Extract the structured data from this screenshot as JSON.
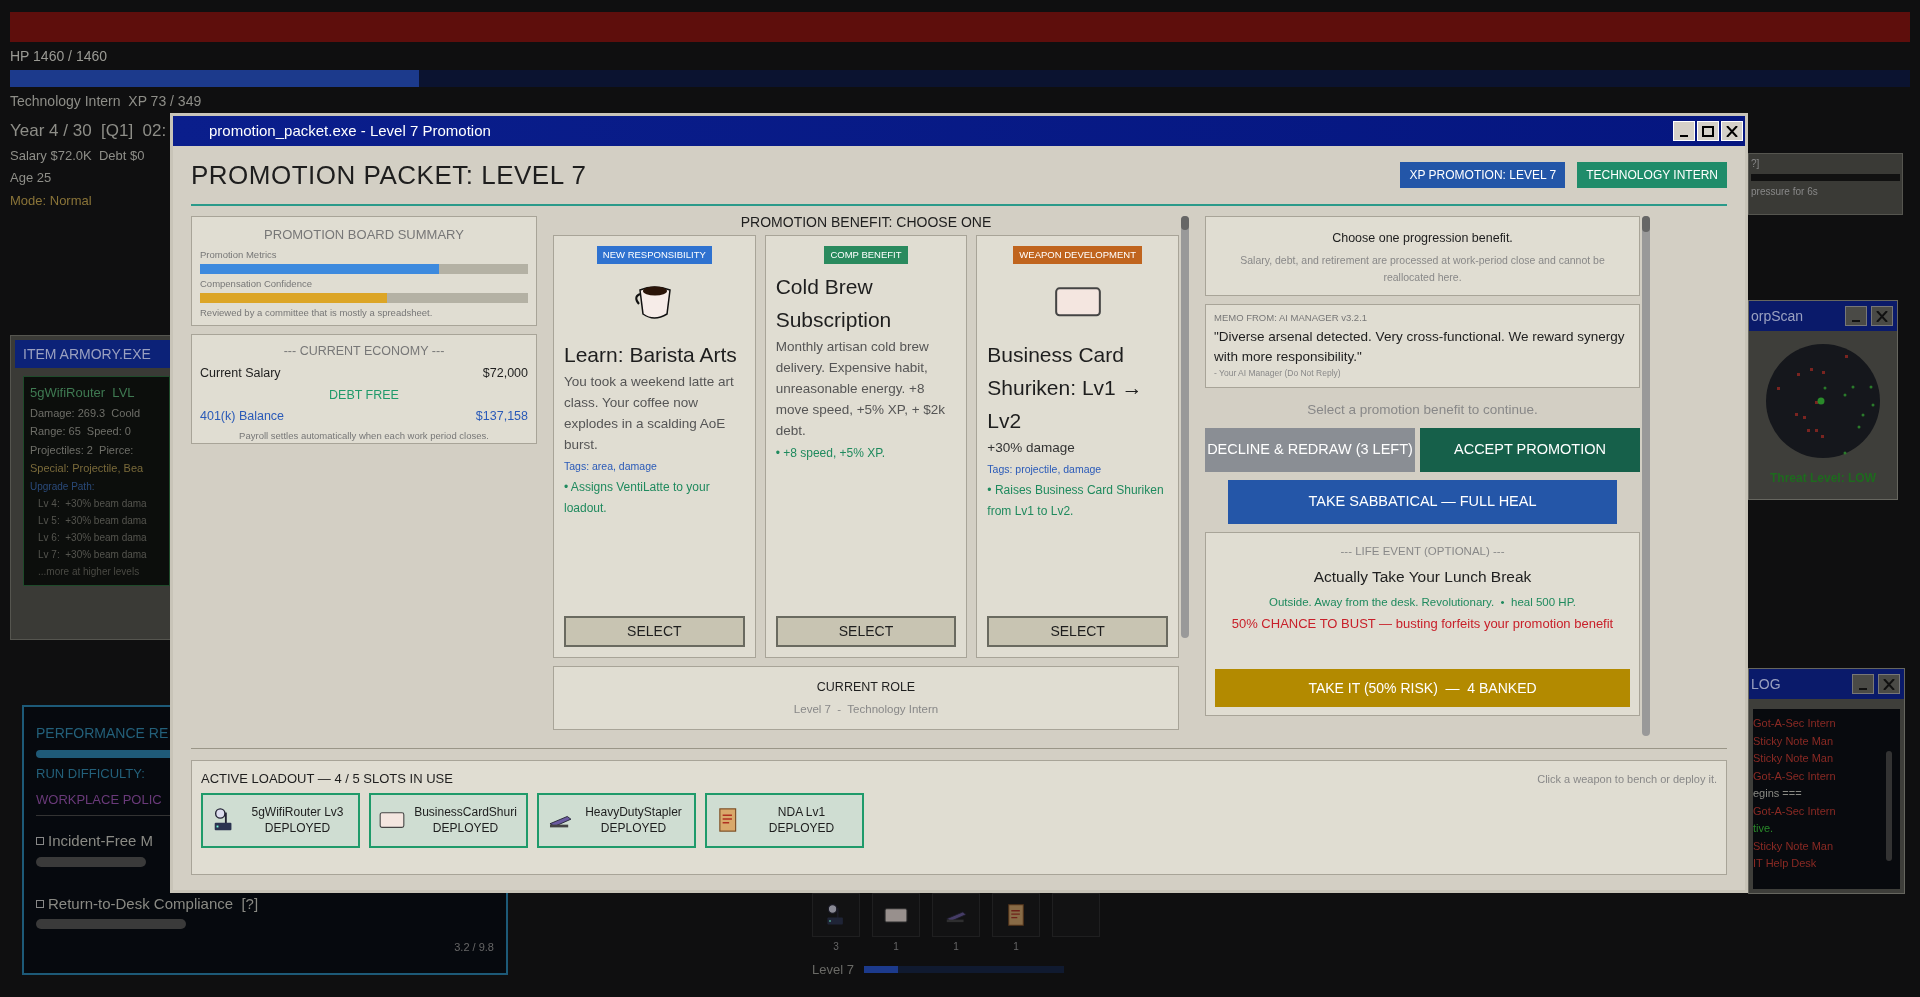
{
  "hud": {
    "hp_bar": {
      "level": 1
    },
    "hp_label": "HP 1460 / 1460",
    "xp_bar": {
      "level": 0.215
    },
    "xp_label": "Technology Intern  XP 73 / 349",
    "date": "Year 4 / 30  [Q1]  02:",
    "finance": "Salary $72.0K  Debt $0",
    "age": "Age 25",
    "mode": "Mode: Normal"
  },
  "armory": {
    "title": "ITEM ARMORY.EXE",
    "weapon": "5gWifiRouter  LVL",
    "stats": [
      "Damage: 269.3  Coold",
      "Range: 65  Speed: 0",
      "Projectiles: 2  Pierce:"
    ],
    "special": "Special: Projectile, Bea",
    "upgrade_title": "Upgrade Path:",
    "upgrades": [
      "Lv 4:  +30% beam dama",
      "Lv 5:  +30% beam dama",
      "Lv 6:  +30% beam dama",
      "Lv 7:  +30% beam dama"
    ],
    "more": "...more at higher levels"
  },
  "performance": {
    "title": "PERFORMANCE RE",
    "difficulty": "RUN DIFFICULTY:",
    "policy": "WORKPLACE POLIC",
    "goals": [
      {
        "label": "Incident-Free M",
        "checked": false
      },
      {
        "label": "Return-to-Desk Compliance  [?]",
        "checked": false
      }
    ],
    "score": "3.2 / 9.8"
  },
  "hotbar": {
    "slots": [
      {
        "kind": "router",
        "count": "3"
      },
      {
        "kind": "card",
        "count": "1"
      },
      {
        "kind": "stapler",
        "count": "1"
      },
      {
        "kind": "document",
        "count": "1"
      },
      {
        "kind": "empty"
      }
    ],
    "level_label": "Level 7",
    "level": 0.17
  },
  "pressure": {
    "help": "?]",
    "text": "pressure for 6s"
  },
  "corpscan": {
    "title": "orpScan",
    "threat": "Threat Level: LOW"
  },
  "log": {
    "title": "LOG",
    "entries": [
      {
        "text": "Got-A-Sec Intern",
        "kind": "enemy"
      },
      {
        "text": "Sticky Note Man",
        "kind": "enemy"
      },
      {
        "text": "Sticky Note Man",
        "kind": "enemy"
      },
      {
        "text": "Got-A-Sec Intern",
        "kind": "enemy"
      },
      {
        "text": "egins ===",
        "kind": "system"
      },
      {
        "text": "Got-A-Sec Intern",
        "kind": "enemy"
      },
      {
        "text": "tive.",
        "kind": "good"
      },
      {
        "text": "Sticky Note Man",
        "kind": "enemy"
      },
      {
        "text": "IT Help Desk",
        "kind": "enemy"
      }
    ]
  },
  "modal": {
    "title": "promotion_packet.exe - Level 7 Promotion",
    "heading": "PROMOTION PACKET: LEVEL 7",
    "badges": [
      {
        "text": "XP PROMOTION: LEVEL 7",
        "color": "#2356a8"
      },
      {
        "text": "TECHNOLOGY INTERN",
        "color": "#1f8c6a"
      }
    ],
    "board": {
      "title": "PROMOTION BOARD SUMMARY",
      "metrics": [
        {
          "label": "Promotion Metrics",
          "level": 0.73,
          "color": "#3d8ade"
        },
        {
          "label": "Compensation Confidence",
          "level": 0.57,
          "color": "#dca526"
        }
      ],
      "note": "Reviewed by a committee that is mostly a spreadsheet."
    },
    "economy": {
      "title": "--- CURRENT ECONOMY ---",
      "salary_label": "Current Salary",
      "salary": "$72,000",
      "debt": "DEBT FREE",
      "balance_label": "401(k) Balance",
      "balance": "$137,158",
      "note": "Payroll settles automatically when each work period closes."
    },
    "benefits": {
      "title": "PROMOTION BENEFIT: CHOOSE ONE",
      "cards": [
        {
          "tag": "NEW RESPONSIBILITY",
          "color": "#2f72d0",
          "kind": "coffee",
          "title": "Learn: Barista Arts",
          "description": "You took a weekend latte art class. Your coffee now explodes in a scalding AoE burst.",
          "tags": "Tags: area, damage",
          "effect": "• Assigns VentiLatte to your loadout.",
          "button": "SELECT"
        },
        {
          "tag": "COMP BENEFIT",
          "color": "#2a8a5e",
          "kind": "text",
          "title": "Cold Brew Subscription",
          "description": "Monthly artisan cold brew delivery. Expensive habit, unreasonable energy. +8 move speed, +5% XP, + $2k debt.",
          "effect": "• +8 speed, +5% XP.",
          "button": "SELECT"
        },
        {
          "tag": "WEAPON DEVELOPMENT",
          "color": "#c0641e",
          "kind": "card",
          "title": "Business Card Shuriken: Lv1 → Lv2",
          "stat": "+30% damage",
          "tags": "Tags: projectile, damage",
          "effect": "• Raises Business Card Shuriken from Lv1 to Lv2.",
          "button": "SELECT"
        }
      ]
    },
    "role": {
      "title": "CURRENT ROLE",
      "detail": "Level 7  -  Technology Intern"
    },
    "terms": {
      "instruction": "Choose one progression benefit.",
      "note": "Salary, debt, and retirement are processed at work-period close and cannot be reallocated here."
    },
    "memo": {
      "header": "MEMO FROM: AI MANAGER v3.2.1",
      "quote": "\"Diverse arsenal detected. Very cross-functional. We reward synergy with more responsibility.\"",
      "signature": "- Your AI Manager (Do Not Reply)"
    },
    "prompt": "Select a promotion benefit to continue.",
    "decline": "DECLINE & REDRAW (3 LEFT)",
    "accept": "ACCEPT PROMOTION",
    "sabbatical": "TAKE SABBATICAL — FULL HEAL",
    "life_event": {
      "header": "--- LIFE EVENT (OPTIONAL) ---",
      "title": "Actually Take Your Lunch Break",
      "effect": "Outside. Away from the desk. Revolutionary.  •  heal 500 HP.",
      "risk": "50% CHANCE TO BUST — busting forfeits your promotion benefit",
      "button": "TAKE IT (50% RISK)  —  4 BANKED"
    },
    "loadout": {
      "title": "ACTIVE LOADOUT — 4 / 5 SLOTS IN USE",
      "hint": "Click a weapon to bench or deploy it.",
      "slots": [
        {
          "kind": "router",
          "name": "5gWifiRouter Lv3",
          "status": "DEPLOYED"
        },
        {
          "kind": "card",
          "name": "BusinessCardShuri",
          "status": "DEPLOYED"
        },
        {
          "kind": "stapler",
          "name": "HeavyDutyStapler",
          "status": "DEPLOYED"
        },
        {
          "kind": "document",
          "name": "NDA Lv1",
          "status": "DEPLOYED"
        }
      ]
    }
  }
}
